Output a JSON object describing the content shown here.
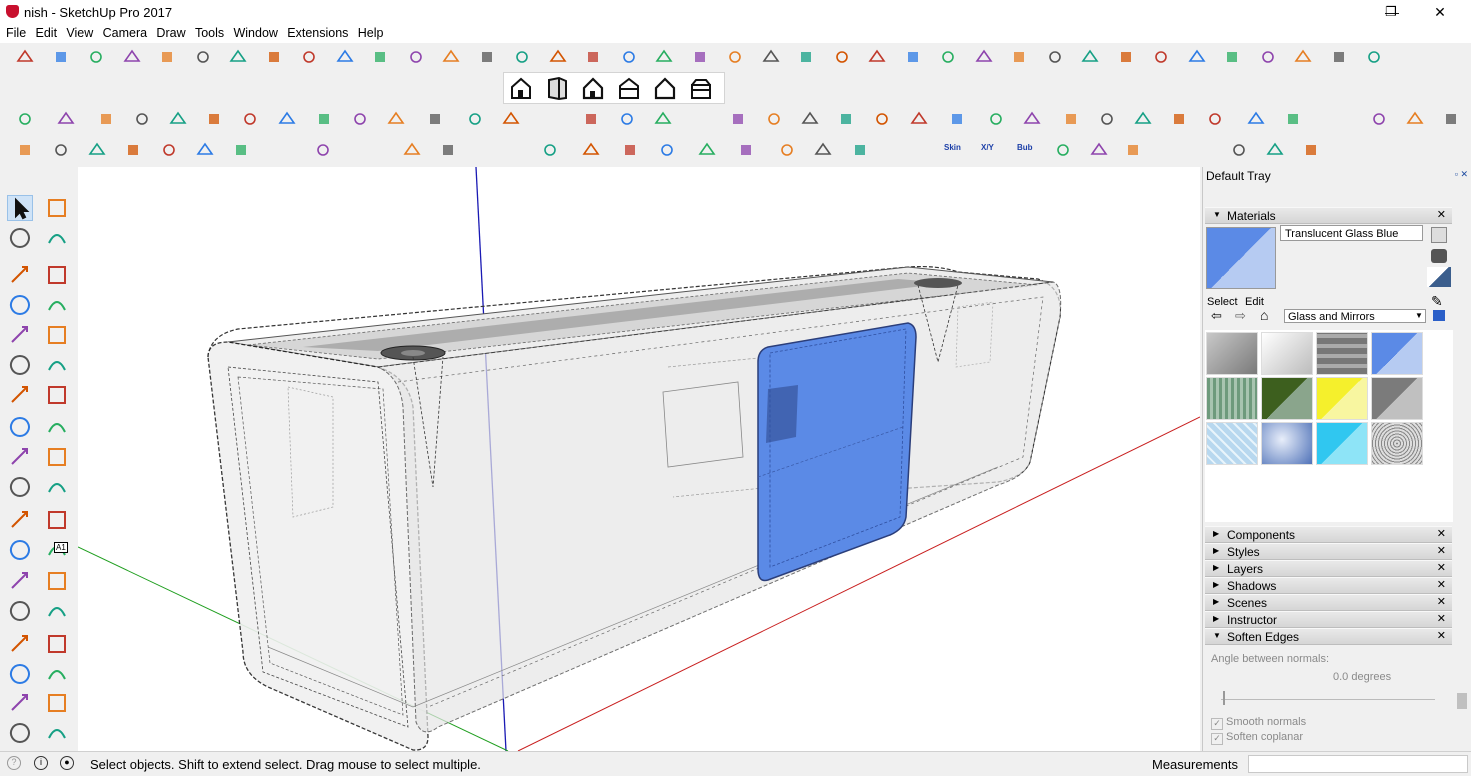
{
  "window": {
    "title": "nish - SketchUp Pro 2017",
    "minimize": "—",
    "maximize": "❐",
    "close": "✕"
  },
  "menu": [
    "File",
    "Edit",
    "View",
    "Camera",
    "Draw",
    "Tools",
    "Window",
    "Extensions",
    "Help"
  ],
  "toolbar_skin_labels": {
    "skin": "Skin",
    "xy": "X/Y",
    "bub": "Bub"
  },
  "left_tool_text_label": "A1",
  "tray": {
    "title": "Default Tray",
    "materials": {
      "header": "Materials",
      "current_material": "Translucent Glass Blue",
      "tab_select": "Select",
      "tab_edit": "Edit",
      "library": "Glass and Mirrors",
      "swatch_colors": [
        "#a9a9a9",
        "#e8e8e8",
        "#8e8e8e",
        "#5b8ae6",
        "#7fa58a",
        "#3d5f1e",
        "#f5f02c",
        "#7b7b7b",
        "#b8d8ef",
        "#6d8cc6",
        "#30c7f0",
        "#bdbdbd"
      ]
    },
    "panels": [
      "Components",
      "Styles",
      "Layers",
      "Shadows",
      "Scenes",
      "Instructor",
      "Soften Edges"
    ],
    "soften_edges": {
      "angle_label": "Angle between normals:",
      "angle_value": "0.0  degrees",
      "smooth_normals": "Smooth normals",
      "soften_coplanar": "Soften coplanar"
    }
  },
  "status": {
    "message": "Select objects. Shift to extend select. Drag mouse to select multiple.",
    "measurements_label": "Measurements"
  },
  "colors": {
    "axis_blue": "#1a1ab4",
    "axis_red": "#c81e1e",
    "axis_green": "#1e9e1e",
    "glass_blue": "#5b8ae6"
  }
}
